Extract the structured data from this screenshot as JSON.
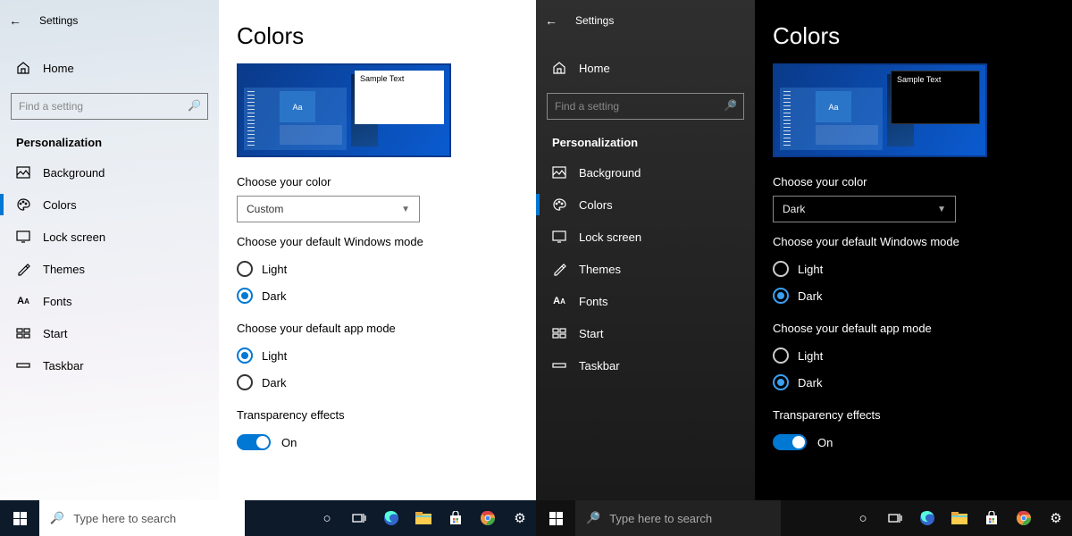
{
  "panes": [
    {
      "theme": "light",
      "color_select": "Custom",
      "win_mode_checked": "dark",
      "app_mode_checked": "light"
    },
    {
      "theme": "dark",
      "color_select": "Dark",
      "win_mode_checked": "dark",
      "app_mode_checked": "dark"
    }
  ],
  "titlebar": {
    "app": "Settings"
  },
  "home_label": "Home",
  "search": {
    "placeholder": "Find a setting"
  },
  "category": "Personalization",
  "nav": [
    {
      "key": "background",
      "label": "Background"
    },
    {
      "key": "colors",
      "label": "Colors"
    },
    {
      "key": "lockscreen",
      "label": "Lock screen"
    },
    {
      "key": "themes",
      "label": "Themes"
    },
    {
      "key": "fonts",
      "label": "Fonts"
    },
    {
      "key": "start",
      "label": "Start"
    },
    {
      "key": "taskbar",
      "label": "Taskbar"
    }
  ],
  "page_title": "Colors",
  "preview_sample": "Sample Text",
  "preview_aa": "Aa",
  "labels": {
    "choose_color": "Choose your color",
    "win_mode": "Choose your default Windows mode",
    "app_mode": "Choose your default app mode",
    "transparency": "Transparency effects",
    "light": "Light",
    "dark": "Dark",
    "on": "On"
  },
  "taskbar": {
    "search_placeholder": "Type here to search"
  }
}
